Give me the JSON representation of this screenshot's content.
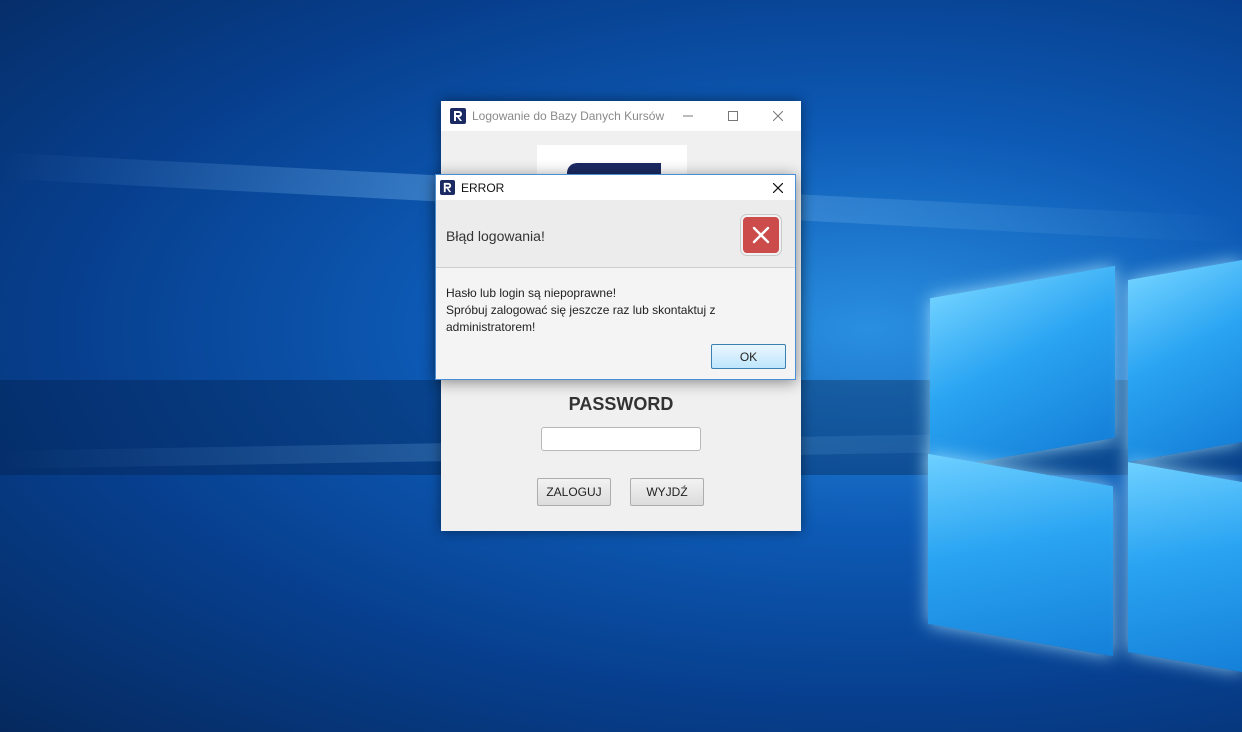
{
  "main_window": {
    "title": "Logowanie do Bazy Danych Kursów",
    "password_label": "PASSWORD",
    "password_value": "",
    "login_button": "ZALOGUJ",
    "exit_button": "WYJDŹ"
  },
  "error_dialog": {
    "title": "ERROR",
    "header": "Błąd logowania!",
    "message_lines": [
      "Hasło lub login są niepoprawne!",
      "Spróbuj zalogować się jeszcze raz lub skontaktuj z",
      "administratorem!"
    ],
    "ok_button": "OK"
  },
  "icons": [
    "app-icon",
    "minimize-icon",
    "maximize-icon",
    "close-icon",
    "error-icon"
  ],
  "colors": {
    "desktop_blue": "#0d5ab5",
    "error_red": "#cc4b4b",
    "app_navy": "#1b2a63"
  }
}
